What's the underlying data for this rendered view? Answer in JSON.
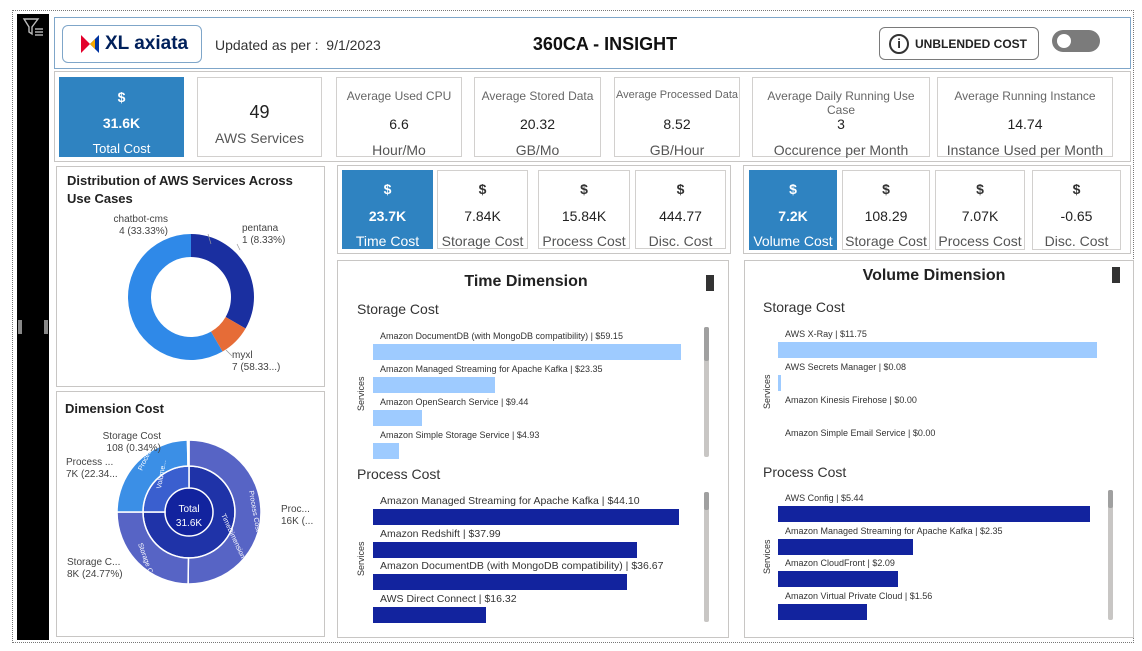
{
  "header": {
    "logo_text": "XL axiata",
    "updated_label": "Updated as per :",
    "updated_date": "9/1/2023",
    "title": "360CA - INSIGHT",
    "unblended_label": "UNBLENDED COST",
    "info_icon": "i"
  },
  "kpis": [
    {
      "label": "$",
      "value": "31.6K",
      "unit": "Total Cost"
    },
    {
      "label": "",
      "value": "49",
      "unit": "AWS Services"
    },
    {
      "label": "Average Used CPU",
      "value": "6.6",
      "unit": "Hour/Mo"
    },
    {
      "label": "Average Stored Data",
      "value": "20.32",
      "unit": "GB/Mo"
    },
    {
      "label": "Average Processed Data",
      "value": "8.52",
      "unit": "GB/Hour"
    },
    {
      "label": "Average Daily Running Use Case",
      "value": "3",
      "unit": "Occurence per Month"
    },
    {
      "label": "Average Running Instance",
      "value": "14.74",
      "unit": "Instance Used per Month"
    }
  ],
  "distribution": {
    "title": "Distribution of AWS Services Across Use Cases",
    "segments": [
      {
        "name": "chatbot-cms",
        "label": "4 (33.33%)",
        "value": 4,
        "color": "#1a2fa0"
      },
      {
        "name": "pentana",
        "label": "1 (8.33%)",
        "value": 1,
        "color": "#e66c37"
      },
      {
        "name": "myxl",
        "label": "7 (58.33...)",
        "value": 7,
        "color": "#2f89e8"
      }
    ]
  },
  "dimension": {
    "title": "Dimension Cost",
    "center_title": "Total",
    "center_value": "31.6K",
    "labels": [
      {
        "name": "Storage Cost",
        "value": "108 (0.34%)"
      },
      {
        "name": "Process ...",
        "value": "7K (22.34..."
      },
      {
        "name": "Storage C...",
        "value": "8K (24.77%)"
      },
      {
        "name": "Proc...",
        "value": "16K (..."
      }
    ],
    "ring_inner": {
      "volume": "Volume...",
      "time": "TimeDimension"
    },
    "ring_outer": {
      "process_small": "Process Cost",
      "storage": "Storage Cost",
      "process": "Process Cost"
    }
  },
  "time_cards": [
    {
      "symbol": "$",
      "value": "23.7K",
      "label": "Time Cost"
    },
    {
      "symbol": "$",
      "value": "7.84K",
      "label": "Storage Cost"
    },
    {
      "symbol": "$",
      "value": "15.84K",
      "label": "Process Cost"
    },
    {
      "symbol": "$",
      "value": "444.77",
      "label": "Disc. Cost"
    }
  ],
  "volume_cards": [
    {
      "symbol": "$",
      "value": "7.2K",
      "label": "Volume Cost"
    },
    {
      "symbol": "$",
      "value": "108.29",
      "label": "Storage Cost"
    },
    {
      "symbol": "$",
      "value": "7.07K",
      "label": "Process Cost"
    },
    {
      "symbol": "$",
      "value": "-0.65",
      "label": "Disc. Cost"
    }
  ],
  "time_dimension": {
    "title": "Time Dimension",
    "axis_label": "Services",
    "storage": {
      "title": "Storage Cost",
      "color": "#9ecbff",
      "items": [
        {
          "label": "Amazon DocumentDB (with MongoDB compatibility) | $59.15",
          "value": 59.15
        },
        {
          "label": "Amazon Managed Streaming for Apache Kafka | $23.35",
          "value": 23.35
        },
        {
          "label": "Amazon OpenSearch Service | $9.44",
          "value": 9.44
        },
        {
          "label": "Amazon Simple Storage Service | $4.93",
          "value": 4.93
        }
      ]
    },
    "process": {
      "title": "Process Cost",
      "color": "#12239e",
      "items": [
        {
          "label": "Amazon Managed Streaming for Apache Kafka | $44.10",
          "value": 44.1
        },
        {
          "label": "Amazon Redshift | $37.99",
          "value": 37.99
        },
        {
          "label": "Amazon DocumentDB (with MongoDB compatibility) | $36.67",
          "value": 36.67
        },
        {
          "label": "AWS Direct Connect | $16.32",
          "value": 16.32
        }
      ]
    }
  },
  "volume_dimension": {
    "title": "Volume Dimension",
    "axis_label": "Services",
    "storage": {
      "title": "Storage Cost",
      "color": "#9ecbff",
      "items": [
        {
          "label": "AWS X-Ray | $11.75",
          "value": 11.75
        },
        {
          "label": "AWS Secrets Manager | $0.08",
          "value": 0.08
        },
        {
          "label": "Amazon Kinesis Firehose | $0.00",
          "value": 0
        },
        {
          "label": "Amazon Simple Email Service | $0.00",
          "value": 0
        }
      ]
    },
    "process": {
      "title": "Process Cost",
      "color": "#12239e",
      "items": [
        {
          "label": "AWS Config | $5.44",
          "value": 5.44
        },
        {
          "label": "Amazon Managed Streaming for Apache Kafka | $2.35",
          "value": 2.35
        },
        {
          "label": "Amazon CloudFront | $2.09",
          "value": 2.09
        },
        {
          "label": "Amazon Virtual Private Cloud | $1.56",
          "value": 1.56
        }
      ]
    }
  }
}
